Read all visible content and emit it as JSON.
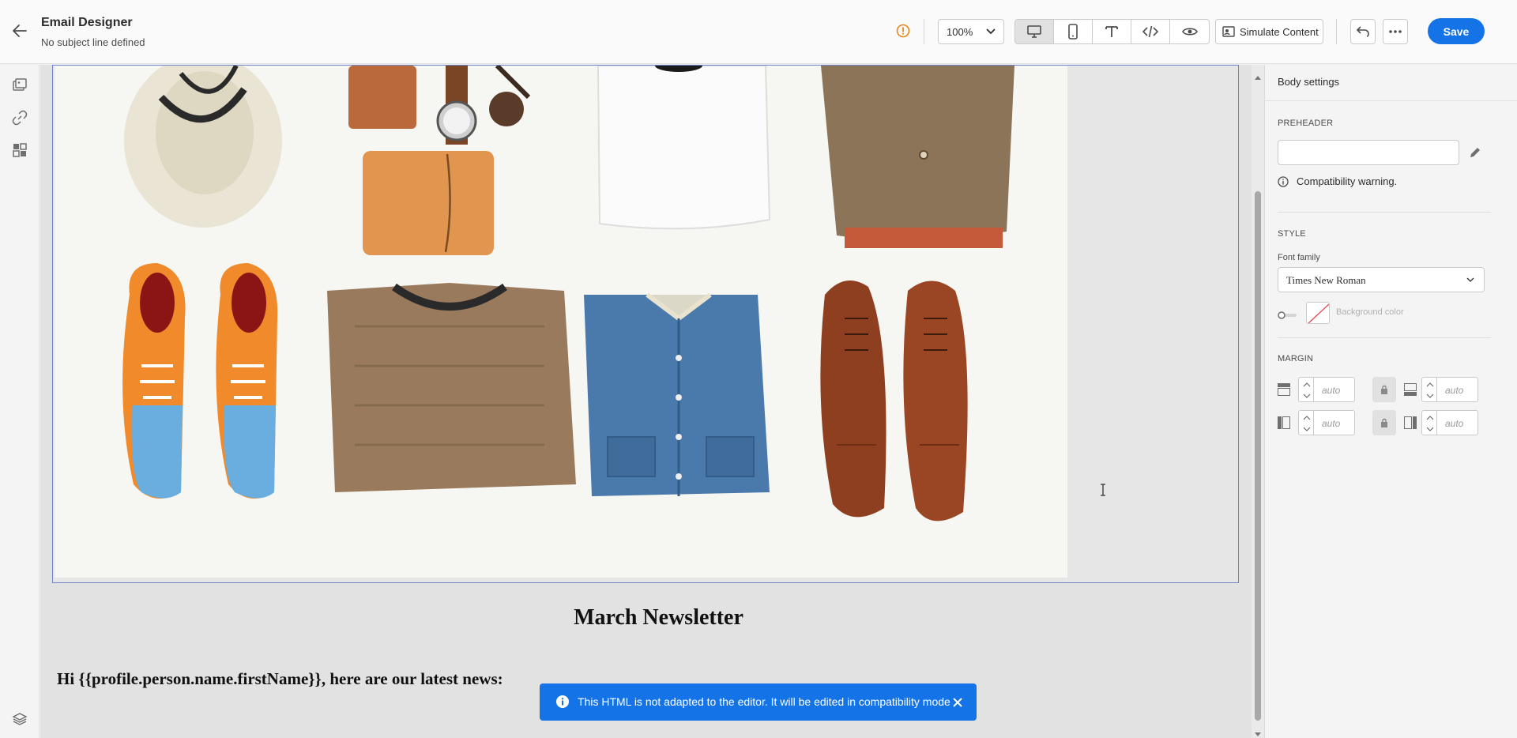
{
  "header": {
    "title": "Email Designer",
    "subtitle": "No subject line defined",
    "zoom": "100%",
    "simulate_label": "Simulate Content",
    "save_label": "Save",
    "view_modes": [
      "desktop",
      "mobile",
      "text",
      "code",
      "preview"
    ],
    "active_view": "desktop"
  },
  "left_rail": {
    "icons": [
      "content-icon",
      "link-icon",
      "components-icon",
      "layers-icon"
    ]
  },
  "canvas": {
    "newsletter_title": "March Newsletter",
    "greeting": "Hi {{profile.person.name.firstName}}, here are our latest news:"
  },
  "right_panel": {
    "title": "Body settings",
    "preheader_label": "PREHEADER",
    "preheader_value": "",
    "compat_warning": "Compatibility warning.",
    "style_label": "STYLE",
    "font_family_label": "Font family",
    "font_family_value": "Times New Roman",
    "background_color_label": "Background color",
    "margin_label": "MARGIN",
    "margins": {
      "top": "auto",
      "bottom": "auto",
      "left": "auto",
      "right": "auto"
    }
  },
  "toast": {
    "message": "This HTML is not adapted to the editor. It will be edited in compatibility mode"
  },
  "colors": {
    "accent": "#1473e6",
    "warning": "#e68619"
  }
}
